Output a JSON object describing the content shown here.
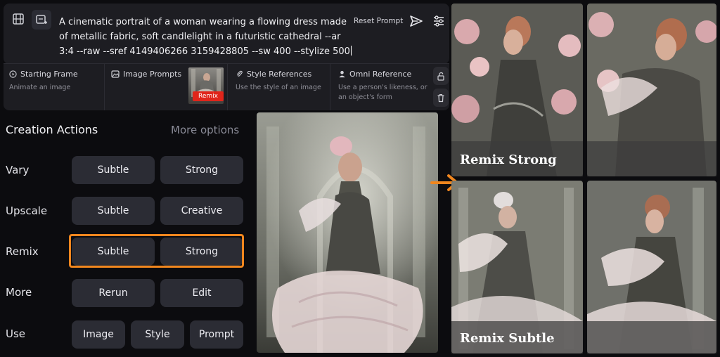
{
  "prompt_bar": {
    "text": "A cinematic portrait of a woman wearing a flowing dress made of metallic fabric, soft candlelight in a futuristic cathedral --ar 3:4 --raw --sref 4149406266 3159428805 --sw 400 --stylize 500",
    "reset_label": "Reset Prompt"
  },
  "refs": {
    "starting_frame": {
      "title": "Starting Frame",
      "subtitle": "Animate an image"
    },
    "image_prompts": {
      "title": "Image Prompts",
      "badge": "Remix"
    },
    "style_references": {
      "title": "Style References",
      "subtitle": "Use the style of an image"
    },
    "omni_reference": {
      "title": "Omni Reference",
      "subtitle_line1": "Use a person's likeness, or",
      "subtitle_line2": "an object's form"
    }
  },
  "actions": {
    "heading": "Creation Actions",
    "more_options": "More options",
    "rows": [
      {
        "label": "Vary",
        "buttons": [
          "Subtle",
          "Strong"
        ]
      },
      {
        "label": "Upscale",
        "buttons": [
          "Subtle",
          "Creative"
        ]
      },
      {
        "label": "Remix",
        "buttons": [
          "Subtle",
          "Strong"
        ]
      },
      {
        "label": "More",
        "buttons": [
          "Rerun",
          "Edit"
        ]
      },
      {
        "label": "Use",
        "buttons": [
          "Image",
          "Style",
          "Prompt"
        ]
      }
    ]
  },
  "results": {
    "strong_caption": "Remix Strong",
    "subtle_caption": "Remix Subtle"
  },
  "colors": {
    "accent": "#f0861e",
    "panel": "#1d1d22",
    "button": "#2b2c34",
    "badge": "#e0251b"
  }
}
